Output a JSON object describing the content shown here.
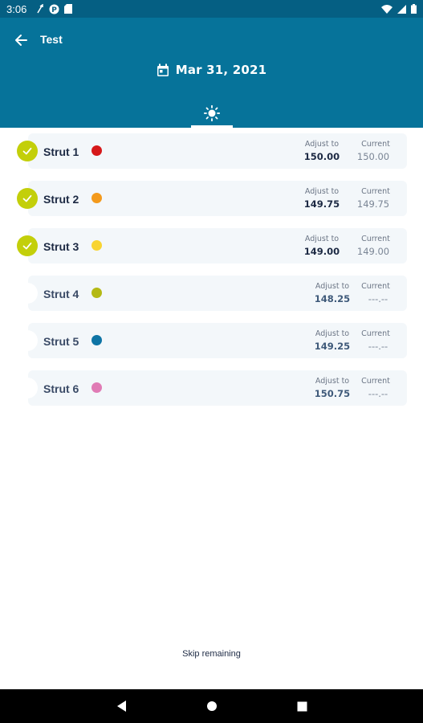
{
  "status_bar": {
    "time": "3:06",
    "icons_left": [
      "signal-arrow-icon",
      "p-badge-icon",
      "sd-card-icon"
    ],
    "icons_right": [
      "wifi-icon",
      "cell-signal-icon",
      "battery-icon"
    ]
  },
  "header": {
    "title": "Test",
    "date": "Mar 31, 2021",
    "tab_icon": "sun-icon"
  },
  "labels": {
    "adjust_to": "Adjust to",
    "current": "Current"
  },
  "struts": [
    {
      "name": "Strut 1",
      "color": "#d6191a",
      "adjust_to": "150.00",
      "current": "150.00",
      "done": true
    },
    {
      "name": "Strut 2",
      "color": "#f39a1c",
      "adjust_to": "149.75",
      "current": "149.75",
      "done": true
    },
    {
      "name": "Strut 3",
      "color": "#f8d432",
      "adjust_to": "149.00",
      "current": "149.00",
      "done": true
    },
    {
      "name": "Strut 4",
      "color": "#b4b914",
      "adjust_to": "148.25",
      "current": "---.--",
      "done": false
    },
    {
      "name": "Strut 5",
      "color": "#0e74a5",
      "adjust_to": "149.25",
      "current": "---.--",
      "done": false
    },
    {
      "name": "Strut 6",
      "color": "#e07bb5",
      "adjust_to": "150.75",
      "current": "---.--",
      "done": false
    }
  ],
  "footer": {
    "skip_label": "Skip remaining"
  },
  "colors": {
    "app_bar": "#06739a",
    "status_bar": "#055f83",
    "check": "#c3cf0a"
  }
}
